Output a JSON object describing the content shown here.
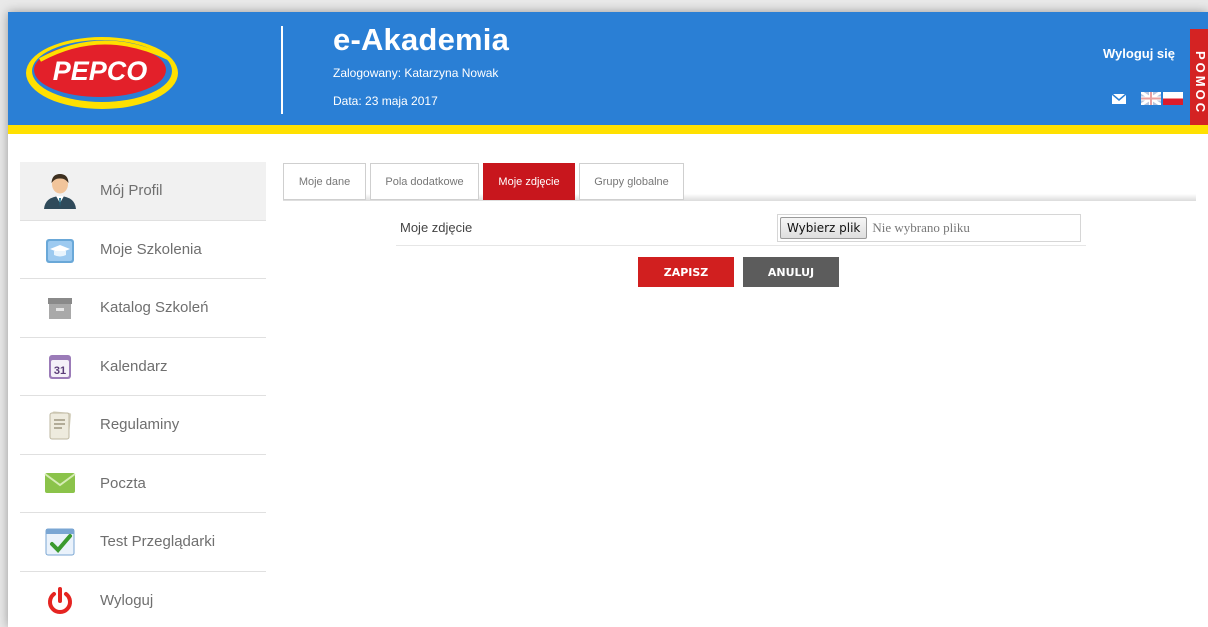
{
  "header": {
    "logo_text": "PEPCO",
    "app_title": "e-Akademia",
    "logged_user": "Zalogowany: Katarzyna Nowak",
    "date": "Data: 23 maja 2017",
    "logout": "Wyloguj się",
    "help": "POMOC"
  },
  "colors": {
    "header_blue": "#2a7fd5",
    "accent_yellow": "#ffe000",
    "accent_red": "#c8161d",
    "cancel_gray": "#5c5c5c"
  },
  "sidebar": {
    "items": [
      {
        "label": "Mój Profil",
        "icon": "user-icon",
        "active": true
      },
      {
        "label": "Moje Szkolenia",
        "icon": "graduation-cap-icon",
        "active": false
      },
      {
        "label": "Katalog Szkoleń",
        "icon": "archive-box-icon",
        "active": false
      },
      {
        "label": "Kalendarz",
        "icon": "calendar-icon",
        "active": false
      },
      {
        "label": "Regulaminy",
        "icon": "document-icon",
        "active": false
      },
      {
        "label": "Poczta",
        "icon": "envelope-icon",
        "active": false
      },
      {
        "label": "Test Przeglądarki",
        "icon": "browser-check-icon",
        "active": false
      },
      {
        "label": "Wyloguj",
        "icon": "power-icon",
        "active": false
      }
    ],
    "calendar_day": "31"
  },
  "tabs": [
    {
      "label": "Moje dane",
      "active": false
    },
    {
      "label": "Pola dodatkowe",
      "active": false
    },
    {
      "label": "Moje zdjęcie",
      "active": true
    },
    {
      "label": "Grupy globalne",
      "active": false
    }
  ],
  "form": {
    "photo_label": "Moje zdjęcie",
    "file_button": "Wybierz plik",
    "file_status": "Nie wybrano pliku",
    "save": "ZAPISZ",
    "cancel": "ANULUJ"
  }
}
